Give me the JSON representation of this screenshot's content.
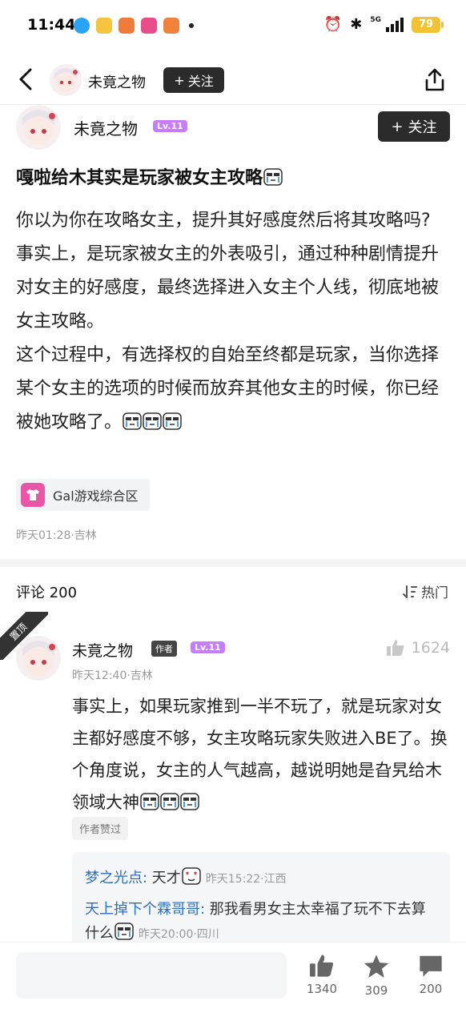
{
  "status_bar": {
    "time": "11:44",
    "network": "5G",
    "battery": "79"
  },
  "nav": {
    "author_name": "未竟之物",
    "follow_label": "关注"
  },
  "author": {
    "name": "未竟之物",
    "level": "Lv.11",
    "follow_label": "关注"
  },
  "post": {
    "title": "嘎啦给木其实是玩家被女主攻略",
    "paragraphs": [
      "你以为你在攻略女主，提升其好感度然后将其攻略吗?",
      "事实上，是玩家被女主的外表吸引，通过种种剧情提升对女主的好感度，最终选择进入女主个人线，彻底地被女主攻略。",
      "这个过程中，有选择权的自始至终都是玩家，当你选择某个女主的选项的时候而放弃其他女主的时候，你已经被她攻略了。"
    ],
    "topic": "Gal游戏综合区",
    "meta": "昨天01:28·吉林"
  },
  "comments": {
    "header": "评论 200",
    "sort_label": "热门",
    "pinned_label": "置顶"
  },
  "comment": {
    "name": "未竟之物",
    "author_tag": "作者",
    "level": "Lv.11",
    "likes": "1624",
    "meta": "昨天12:40·吉林",
    "body": "事实上，如果玩家推到一半不玩了，就是玩家对女主都好感度不够，女主攻略玩家失败进入BE了。换个角度说，女主的人气越高，越说明她是旮旯给木领域大神",
    "liked_label": "作者赞过",
    "replies": [
      {
        "user": "梦之光点:",
        "text": " 天才",
        "meta": "昨天15:22·江西"
      },
      {
        "user": "天上掉下个霖哥哥:",
        "text": " 那我看男女主太幸福了玩不下去算什么",
        "meta": "昨天20:00·四川"
      }
    ]
  },
  "bottom_bar": {
    "likes": "1340",
    "favorites": "309",
    "comments": "200"
  },
  "colors": {
    "accent_purple": "#c77dff",
    "link_blue": "#2d6fbf",
    "dark_button": "#2b2b2b",
    "battery": "#f1c232"
  }
}
